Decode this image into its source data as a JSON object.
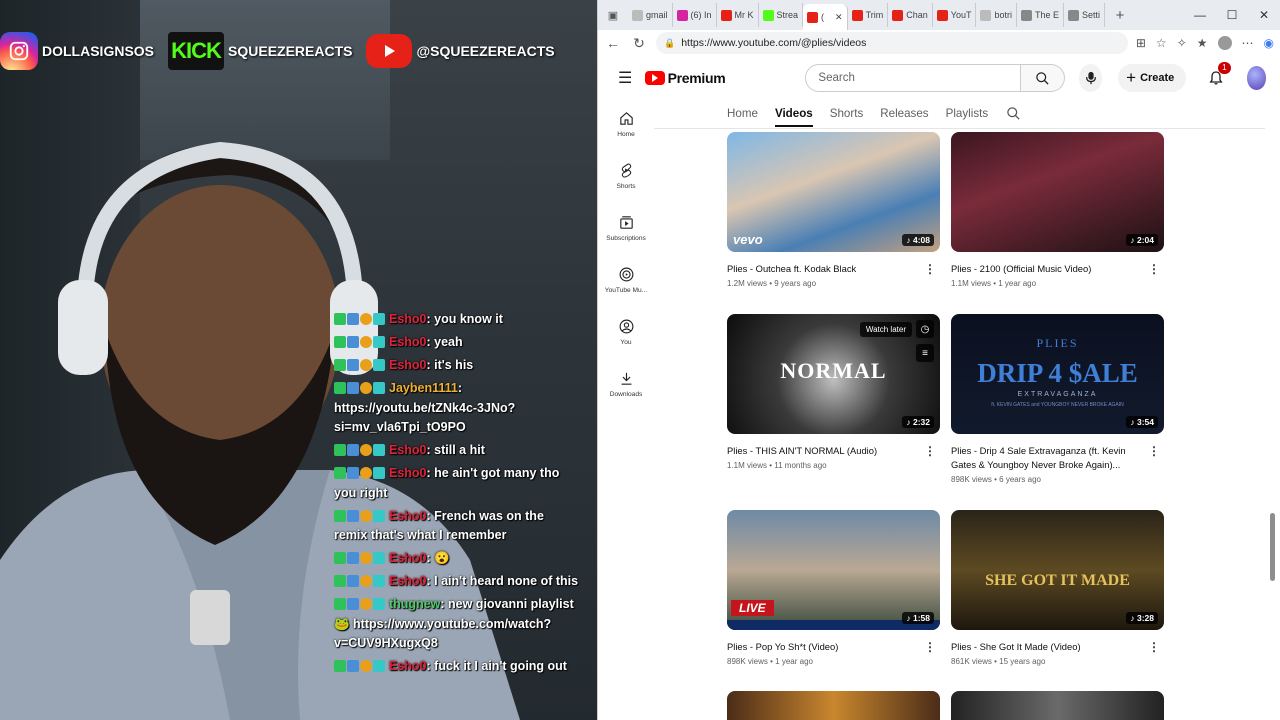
{
  "overlay": {
    "socials": [
      {
        "platform": "instagram",
        "handle": "DOLLASIGNSOS"
      },
      {
        "platform": "kick",
        "handle": "SQUEEZEREACTS"
      },
      {
        "platform": "youtube",
        "handle": "@SQUEEZEREACTS"
      }
    ],
    "kick_logo_text": "KICK",
    "chat": [
      {
        "user": "Esho0",
        "color": "#e0233a",
        "text": ": you know it"
      },
      {
        "user": "Esho0",
        "color": "#e0233a",
        "text": ": yeah"
      },
      {
        "user": "Esho0",
        "color": "#e0233a",
        "text": ": it's his"
      },
      {
        "user": "Jayben1111",
        "color": "#f0b133",
        "text": ": https://youtu.be/tZNk4c-3JNo?si=mv_vla6Tpi_tO9PO"
      },
      {
        "user": "Esho0",
        "color": "#e0233a",
        "text": ": still a hit"
      },
      {
        "user": "Esho0",
        "color": "#e0233a",
        "text": ": he ain't got many tho you right"
      },
      {
        "user": "Esho0",
        "color": "#e0233a",
        "text": ": French was on the remix that's what I remember"
      },
      {
        "user": "Esho0",
        "color": "#e0233a",
        "text": ": 😮"
      },
      {
        "user": "Esho0",
        "color": "#e0233a",
        "text": ": I ain't heard none of this"
      },
      {
        "user": "thugnew",
        "color": "#52c96b",
        "text": ": new giovanni playlist 🐸 https://www.youtube.com/watch?v=CUV9HXugxQ8"
      },
      {
        "user": "Esho0",
        "color": "#e0233a",
        "text": ": fuck it I ain't going out"
      }
    ]
  },
  "browser": {
    "tabs": [
      {
        "label": "gmail",
        "color": "#bbb"
      },
      {
        "label": "(6) In",
        "color": "#d6249f"
      },
      {
        "label": "Mr K",
        "color": "#e62117"
      },
      {
        "label": "Strea",
        "color": "#53fc18"
      },
      {
        "label": "(",
        "color": "#e62117"
      },
      {
        "label": "Trim",
        "color": "#e62117"
      },
      {
        "label": "Chan",
        "color": "#e62117"
      },
      {
        "label": "YouT",
        "color": "#e62117"
      },
      {
        "label": "botri",
        "color": "#bbb"
      },
      {
        "label": "The E",
        "color": "#888"
      },
      {
        "label": "Setti",
        "color": "#888"
      }
    ],
    "active_tab_index": 4,
    "url": "https://www.youtube.com/@plies/videos"
  },
  "youtube": {
    "logo_text": "Premium",
    "search_placeholder": "Search",
    "create_label": "Create",
    "notification_count": "1",
    "sidebar": [
      {
        "label": "Home",
        "icon": "home-icon"
      },
      {
        "label": "Shorts",
        "icon": "shorts-icon"
      },
      {
        "label": "Subscriptions",
        "icon": "subscriptions-icon"
      },
      {
        "label": "YouTube Mu...",
        "icon": "music-icon"
      },
      {
        "label": "You",
        "icon": "you-icon"
      },
      {
        "label": "Downloads",
        "icon": "download-icon"
      }
    ],
    "channel_tabs": [
      "Home",
      "Videos",
      "Shorts",
      "Releases",
      "Playlists"
    ],
    "active_channel_tab": "Videos",
    "videos": [
      {
        "title": "Plies - Outchea ft. Kodak Black",
        "meta": "1.2M views • 9 years ago",
        "duration": "4:08",
        "watermark": "vevo"
      },
      {
        "title": "Plies - 2100 (Official Music Video)",
        "meta": "1.1M views • 1 year ago",
        "duration": "2:04"
      },
      {
        "title": "Plies - THIS AIN'T NORMAL (Audio)",
        "meta": "1.1M views • 11 months ago",
        "duration": "2:32",
        "hover": "Watch later",
        "art_text": "NORMAL"
      },
      {
        "title": "Plies - Drip 4 Sale Extravaganza (ft. Kevin Gates & Youngboy Never Broke Again)...",
        "meta": "898K views • 6 years ago",
        "duration": "3:54",
        "art_text": "DRIP 4 $ALE",
        "art_sub": "EXTRAVAGANZA",
        "art_top": "PLIES",
        "art_feat": "ft. KEVIN GATES and YOUNGBOY NEVER BROKE AGAIN"
      },
      {
        "title": "Plies - Pop Yo Sh*t (Video)",
        "meta": "898K views • 1 year ago",
        "duration": "1:58",
        "art_text": "LIVE"
      },
      {
        "title": "Plies - She Got It Made (Video)",
        "meta": "861K views • 15 years ago",
        "duration": "3:28",
        "art_text": "SHE GOT IT MADE"
      }
    ]
  }
}
